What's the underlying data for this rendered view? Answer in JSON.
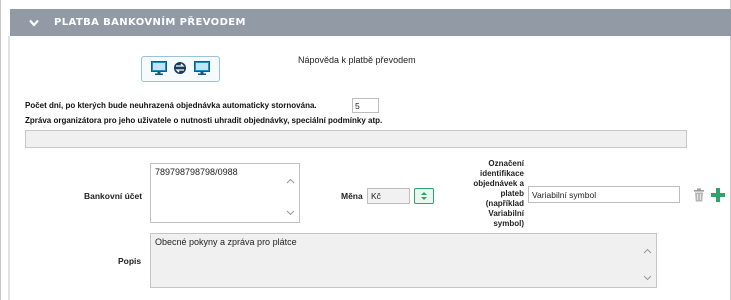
{
  "panel": {
    "title": "PLATBA BANKOVNÍM PŘEVODEM",
    "help_text": "Nápověda k platbě převodem"
  },
  "settings": {
    "auto_cancel_label": "Počet dní, po kterých bude neuhrazená objednávka automaticky stornována.",
    "auto_cancel_days": "5",
    "message_label": "Zpráva organizátora pro jeho uživatele o nutnosti uhradit objednávky, speciální podmínky atp.",
    "message_value": ""
  },
  "account": {
    "bank_label": "Bankovní účet",
    "bank_value": "789798798798/0988",
    "currency_label": "Měna",
    "currency_value": "Kč",
    "ident_label_lines": [
      "Označení",
      "identifikace",
      "objednávek a",
      "plateb",
      "(například",
      "Variabilní",
      "symbol)"
    ],
    "ident_value": "Variabilní symbol",
    "popis_label": "Popis",
    "popis_value": "Obecné pokyny a zpráva pro plátce"
  },
  "colors": {
    "header_bg": "#929ba5",
    "accent_green": "#2ea36c",
    "help_border": "#9fc1d6"
  },
  "icons": {
    "header": "chevron-down-icon",
    "help": [
      "monitor-icon",
      "transfer-icon",
      "monitor-icon"
    ],
    "row_actions": [
      "trash-icon",
      "plus-icon"
    ]
  }
}
